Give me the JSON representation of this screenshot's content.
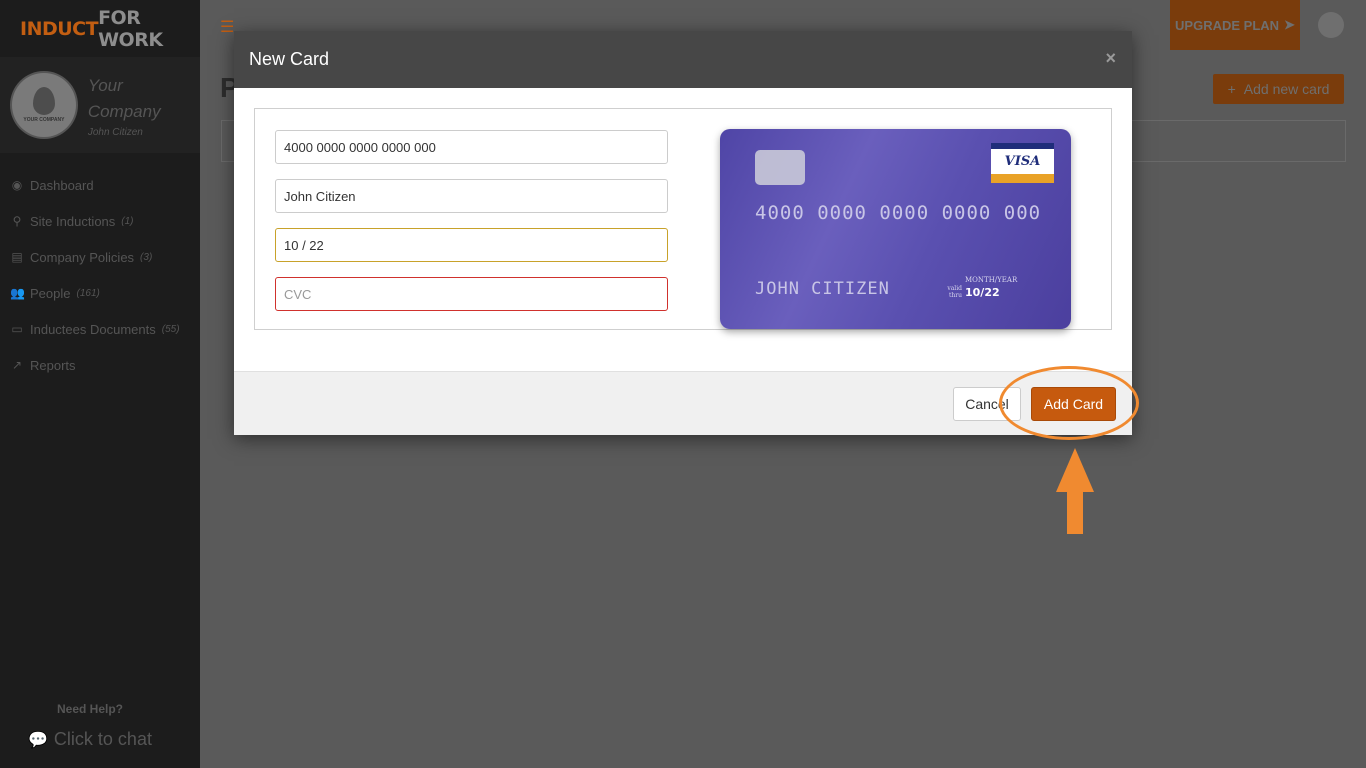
{
  "brand": {
    "part1": "INDUCT",
    "part2": "FOR WORK"
  },
  "profile": {
    "avatar_text": "YOUR COMPANY",
    "company_name": "Your Company",
    "user_name": "John Citizen"
  },
  "sidebar": {
    "items": [
      {
        "label": "Dashboard",
        "count": ""
      },
      {
        "label": "Site Inductions",
        "count": "(1)"
      },
      {
        "label": "Company Policies",
        "count": "(3)"
      },
      {
        "label": "People",
        "count": "(161)"
      },
      {
        "label": "Inductees Documents",
        "count": "(55)"
      },
      {
        "label": "Reports",
        "count": ""
      }
    ],
    "help_label": "Need Help?",
    "chat_label": "Click to chat"
  },
  "topbar": {
    "upgrade_label": "UPGRADE PLAN"
  },
  "page": {
    "heading": "P",
    "add_new_label": "Add new card"
  },
  "modal": {
    "title": "New Card",
    "close_symbol": "×",
    "fields": {
      "card_number": "4000 0000 0000 0000 000",
      "name": "John Citizen",
      "expiry": "10 / 22",
      "cvc_placeholder": "CVC"
    },
    "card_preview": {
      "brand": "VISA",
      "number": "4000 0000 0000 0000 000",
      "name": "JOHN CITIZEN",
      "valid_thru_label": "valid thru",
      "month_year_label": "MONTH/YEAR",
      "expiry": "10/22"
    },
    "cancel_label": "Cancel",
    "add_label": "Add Card"
  },
  "colors": {
    "accent": "#c65a0e",
    "annotation": "#f08a30",
    "card": "#5a50b0"
  }
}
